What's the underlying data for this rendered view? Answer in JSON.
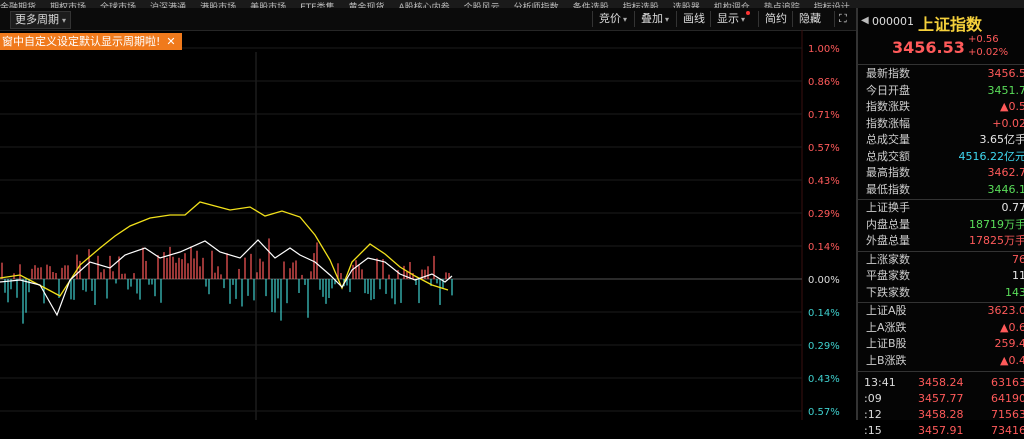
{
  "top_menu": [
    "金融期货",
    "期权市场",
    "全球市场",
    "沪深港通",
    "港股市场",
    "美股市场",
    "ETF类集",
    "黄金现货",
    "A股核心内参",
    "个股风云",
    "分析师指数",
    "条件选股",
    "指标选股",
    "选股器",
    "机构调仓",
    "热点追踪",
    "指标设计",
    "..."
  ],
  "toolbar": {
    "period_label": "更多周期",
    "tools": [
      "竞价",
      "叠加",
      "画线",
      "显示",
      "简约",
      "隐藏"
    ]
  },
  "notice": {
    "text": "窗中自定义设定默认显示周期啦!",
    "close": "✕"
  },
  "percent_scale": {
    "up": [
      "1.00%",
      "0.86%",
      "0.71%",
      "0.57%",
      "0.43%",
      "0.29%",
      "0.14%"
    ],
    "zero": "0.00%",
    "down": [
      "0.14%",
      "0.29%",
      "0.43%",
      "0.57%"
    ]
  },
  "colors": {
    "up": "#ff5a5a",
    "down": "#3fd0ce",
    "price_line": "#ffffff",
    "avg_line": "#f2e11b",
    "accent": "#f07a1c",
    "name": "#f5d03b",
    "value_green": "#5ade5a"
  },
  "quote": {
    "code": "000001",
    "name": "上证指数",
    "price": "3456.53",
    "change": "+0.56",
    "change_pct": "+0.02%"
  },
  "stats": [
    {
      "label": "最新指数",
      "value": "3456.5",
      "color": "up"
    },
    {
      "label": "今日开盘",
      "value": "3451.7",
      "color": "green"
    },
    {
      "label": "指数涨跌",
      "value": "▲0.5",
      "color": "up"
    },
    {
      "label": "指数涨幅",
      "value": "+0.02",
      "color": "up"
    },
    {
      "label": "总成交量",
      "value": "3.65亿手",
      "color": "white"
    },
    {
      "label": "总成交额",
      "value": "4516.22亿元",
      "color": "cyan"
    },
    {
      "label": "最高指数",
      "value": "3462.7",
      "color": "up"
    },
    {
      "label": "最低指数",
      "value": "3446.1",
      "color": "green"
    }
  ],
  "stats2": [
    {
      "label": "上证换手",
      "value": "0.77",
      "color": "white"
    },
    {
      "label": "内盘总量",
      "value": "18719万手",
      "color": "green"
    },
    {
      "label": "外盘总量",
      "value": "17825万手",
      "color": "up"
    }
  ],
  "stats3": [
    {
      "label": "上涨家数",
      "value": "76",
      "color": "up"
    },
    {
      "label": "平盘家数",
      "value": "11",
      "color": "white"
    },
    {
      "label": "下跌家数",
      "value": "143",
      "color": "green"
    }
  ],
  "stats4": [
    {
      "label": "上证A股",
      "value": "3623.0",
      "color": "up"
    },
    {
      "label": "上A涨跌",
      "value": "▲0.6",
      "color": "up"
    },
    {
      "label": "上证B股",
      "value": "259.4",
      "color": "up"
    },
    {
      "label": "上B涨跌",
      "value": "▲0.4",
      "color": "up"
    }
  ],
  "ticks": [
    {
      "time": "13:41",
      "price": "3458.24",
      "vol": "63163"
    },
    {
      "time": ":09",
      "price": "3457.77",
      "vol": "64190"
    },
    {
      "time": ":12",
      "price": "3458.28",
      "vol": "71563"
    },
    {
      "time": ":15",
      "price": "3457.91",
      "vol": "73416"
    }
  ]
}
